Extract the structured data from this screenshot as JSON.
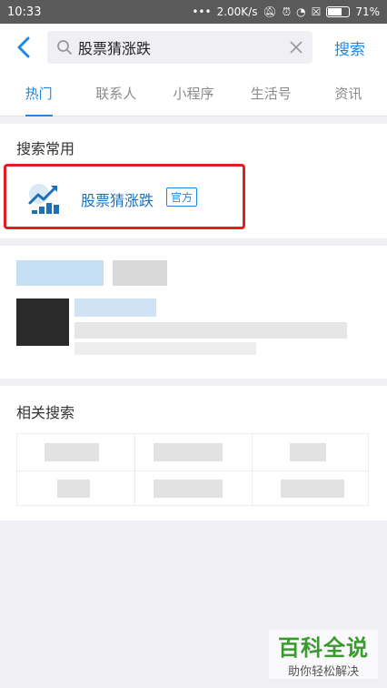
{
  "status_bar": {
    "time": "10:33",
    "network_speed": "2.00K/s",
    "battery": "71%",
    "battery_level": 0.71
  },
  "search": {
    "back_icon": "chevron-left-icon",
    "query": "股票猜涨跌",
    "search_label": "搜索"
  },
  "tabs": [
    {
      "label": "热门",
      "active": true
    },
    {
      "label": "联系人",
      "active": false
    },
    {
      "label": "小程序",
      "active": false
    },
    {
      "label": "生活号",
      "active": false
    },
    {
      "label": "资讯",
      "active": false
    }
  ],
  "frequent": {
    "title": "搜索常用",
    "app_name": "股票猜涨跌",
    "badge": "官方"
  },
  "related": {
    "title": "相关搜索"
  },
  "watermark": {
    "title": "百科全说",
    "subtitle": "助你轻松解决"
  },
  "colors": {
    "accent": "#1e88e5",
    "highlight_border": "#e02020",
    "watermark_green": "#3a9a2e"
  }
}
